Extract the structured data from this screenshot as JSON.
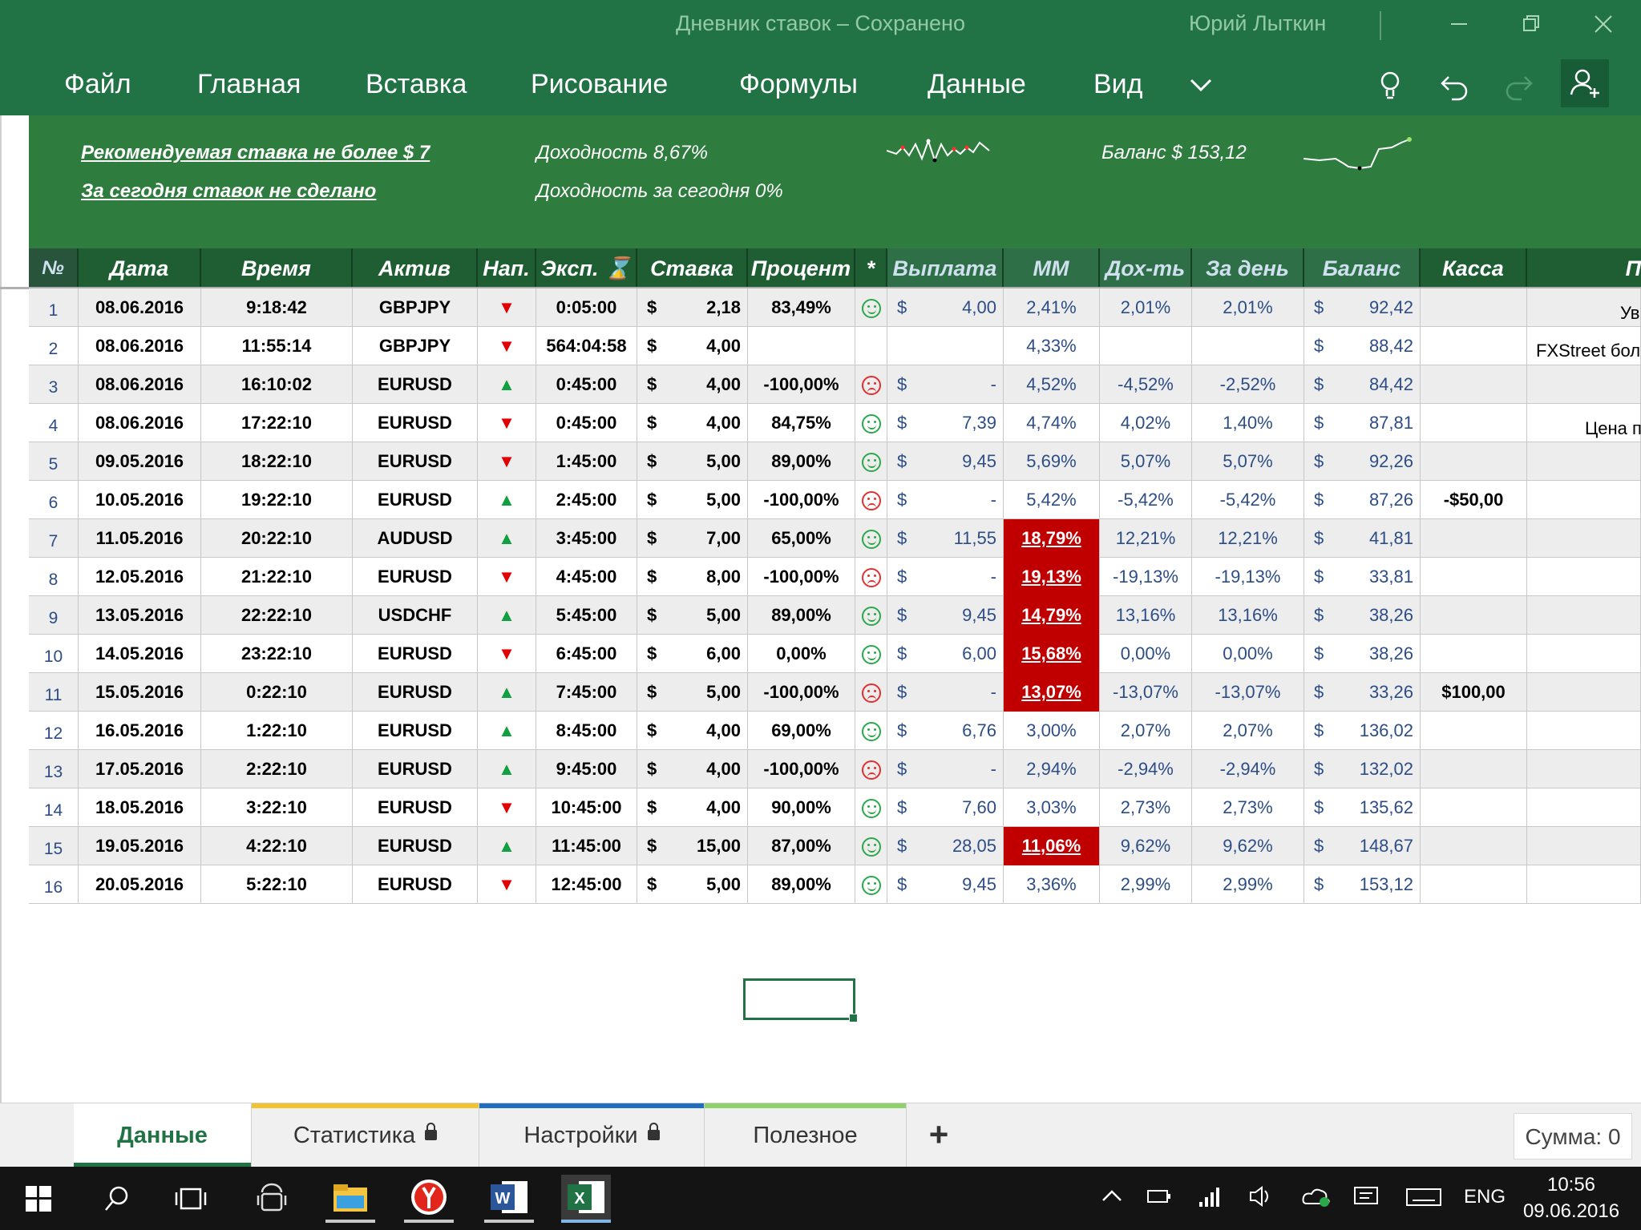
{
  "titlebar": {
    "title": "Дневник ставок – Сохранено",
    "user": "Юрий Лыткин"
  },
  "menu": [
    "Файл",
    "Главная",
    "Вставка",
    "Рисование",
    "Формулы",
    "Данные",
    "Вид"
  ],
  "banner": {
    "recommend": "Рекомендуемая ставка не более $ 7",
    "no_bets_today": "За сегодня ставок не сделано",
    "yield": "Доходность  8,67%",
    "yield_today": "Доходность за сегодня  0%",
    "balance": "Баланс  $ 153,12"
  },
  "headers": {
    "num": "№",
    "date": "Дата",
    "time": "Время",
    "asset": "Актив",
    "dir": "Нап.",
    "exp": "Эксп.",
    "stake": "Ставка",
    "pct": "Процент",
    "star": "*",
    "payout": "Выплата",
    "mm": "ММ",
    "yield": "Дох-ть",
    "day": "За день",
    "balance": "Баланс",
    "cash": "Касса",
    "extra": "П"
  },
  "rows": [
    {
      "n": "1",
      "date": "08.06.2016",
      "time": "9:18:42",
      "asset": "GBPJPY",
      "dir": "down",
      "exp": "0:05:00",
      "stake": "2,18",
      "pct": "83,49%",
      "res": "win",
      "pay": "4,00",
      "mm": "2,41%",
      "mmred": false,
      "yld": "2,01%",
      "day": "2,01%",
      "bal": "92,42",
      "cash": ""
    },
    {
      "n": "2",
      "date": "08.06.2016",
      "time": "11:55:14",
      "asset": "GBPJPY",
      "dir": "down",
      "exp": "564:04:58",
      "stake": "4,00",
      "pct": "",
      "res": "",
      "pay": "",
      "mm": "4,33%",
      "mmred": false,
      "yld": "",
      "day": "",
      "bal": "88,42",
      "cash": ""
    },
    {
      "n": "3",
      "date": "08.06.2016",
      "time": "16:10:02",
      "asset": "EURUSD",
      "dir": "up",
      "exp": "0:45:00",
      "stake": "4,00",
      "pct": "-100,00%",
      "res": "loss",
      "pay": "-",
      "mm": "4,52%",
      "mmred": false,
      "yld": "-4,52%",
      "day": "-2,52%",
      "bal": "84,42",
      "cash": ""
    },
    {
      "n": "4",
      "date": "08.06.2016",
      "time": "17:22:10",
      "asset": "EURUSD",
      "dir": "down",
      "exp": "0:45:00",
      "stake": "4,00",
      "pct": "84,75%",
      "res": "win",
      "pay": "7,39",
      "mm": "4,74%",
      "mmred": false,
      "yld": "4,02%",
      "day": "1,40%",
      "bal": "87,81",
      "cash": ""
    },
    {
      "n": "5",
      "date": "09.05.2016",
      "time": "18:22:10",
      "asset": "EURUSD",
      "dir": "down",
      "exp": "1:45:00",
      "stake": "5,00",
      "pct": "89,00%",
      "res": "win",
      "pay": "9,45",
      "mm": "5,69%",
      "mmred": false,
      "yld": "5,07%",
      "day": "5,07%",
      "bal": "92,26",
      "cash": ""
    },
    {
      "n": "6",
      "date": "10.05.2016",
      "time": "19:22:10",
      "asset": "EURUSD",
      "dir": "up",
      "exp": "2:45:00",
      "stake": "5,00",
      "pct": "-100,00%",
      "res": "loss",
      "pay": "-",
      "mm": "5,42%",
      "mmred": false,
      "yld": "-5,42%",
      "day": "-5,42%",
      "bal": "87,26",
      "cash": "-$50,00"
    },
    {
      "n": "7",
      "date": "11.05.2016",
      "time": "20:22:10",
      "asset": "AUDUSD",
      "dir": "up",
      "exp": "3:45:00",
      "stake": "7,00",
      "pct": "65,00%",
      "res": "win",
      "pay": "11,55",
      "mm": "18,79%",
      "mmred": true,
      "yld": "12,21%",
      "day": "12,21%",
      "bal": "41,81",
      "cash": ""
    },
    {
      "n": "8",
      "date": "12.05.2016",
      "time": "21:22:10",
      "asset": "EURUSD",
      "dir": "down",
      "exp": "4:45:00",
      "stake": "8,00",
      "pct": "-100,00%",
      "res": "loss",
      "pay": "-",
      "mm": "19,13%",
      "mmred": true,
      "yld": "-19,13%",
      "day": "-19,13%",
      "bal": "33,81",
      "cash": ""
    },
    {
      "n": "9",
      "date": "13.05.2016",
      "time": "22:22:10",
      "asset": "USDCHF",
      "dir": "up",
      "exp": "5:45:00",
      "stake": "5,00",
      "pct": "89,00%",
      "res": "win",
      "pay": "9,45",
      "mm": "14,79%",
      "mmred": true,
      "yld": "13,16%",
      "day": "13,16%",
      "bal": "38,26",
      "cash": ""
    },
    {
      "n": "10",
      "date": "14.05.2016",
      "time": "23:22:10",
      "asset": "EURUSD",
      "dir": "down",
      "exp": "6:45:00",
      "stake": "6,00",
      "pct": "0,00%",
      "res": "win",
      "pay": "6,00",
      "mm": "15,68%",
      "mmred": true,
      "yld": "0,00%",
      "day": "0,00%",
      "bal": "38,26",
      "cash": ""
    },
    {
      "n": "11",
      "date": "15.05.2016",
      "time": "0:22:10",
      "asset": "EURUSD",
      "dir": "up",
      "exp": "7:45:00",
      "stake": "5,00",
      "pct": "-100,00%",
      "res": "loss",
      "pay": "-",
      "mm": "13,07%",
      "mmred": true,
      "yld": "-13,07%",
      "day": "-13,07%",
      "bal": "33,26",
      "cash": "$100,00"
    },
    {
      "n": "12",
      "date": "16.05.2016",
      "time": "1:22:10",
      "asset": "EURUSD",
      "dir": "up",
      "exp": "8:45:00",
      "stake": "4,00",
      "pct": "69,00%",
      "res": "win",
      "pay": "6,76",
      "mm": "3,00%",
      "mmred": false,
      "yld": "2,07%",
      "day": "2,07%",
      "bal": "136,02",
      "cash": ""
    },
    {
      "n": "13",
      "date": "17.05.2016",
      "time": "2:22:10",
      "asset": "EURUSD",
      "dir": "up",
      "exp": "9:45:00",
      "stake": "4,00",
      "pct": "-100,00%",
      "res": "loss",
      "pay": "-",
      "mm": "2,94%",
      "mmred": false,
      "yld": "-2,94%",
      "day": "-2,94%",
      "bal": "132,02",
      "cash": ""
    },
    {
      "n": "14",
      "date": "18.05.2016",
      "time": "3:22:10",
      "asset": "EURUSD",
      "dir": "down",
      "exp": "10:45:00",
      "stake": "4,00",
      "pct": "90,00%",
      "res": "win",
      "pay": "7,60",
      "mm": "3,03%",
      "mmred": false,
      "yld": "2,73%",
      "day": "2,73%",
      "bal": "135,62",
      "cash": ""
    },
    {
      "n": "15",
      "date": "19.05.2016",
      "time": "4:22:10",
      "asset": "EURUSD",
      "dir": "up",
      "exp": "11:45:00",
      "stake": "15,00",
      "pct": "87,00%",
      "res": "win",
      "pay": "28,05",
      "mm": "11,06%",
      "mmred": true,
      "yld": "9,62%",
      "day": "9,62%",
      "bal": "148,67",
      "cash": ""
    },
    {
      "n": "16",
      "date": "20.05.2016",
      "time": "5:22:10",
      "asset": "EURUSD",
      "dir": "down",
      "exp": "12:45:00",
      "stake": "5,00",
      "pct": "89,00%",
      "res": "win",
      "pay": "9,45",
      "mm": "3,36%",
      "mmred": false,
      "yld": "2,99%",
      "day": "2,99%",
      "bal": "153,12",
      "cash": ""
    }
  ],
  "side_notes": [
    "Ув",
    "FXStreet бол",
    "Цена п"
  ],
  "currency_symbol": "$",
  "sheet_tabs": [
    {
      "label": "Данные",
      "active": true,
      "color": "#217346"
    },
    {
      "label": "Статистика",
      "locked": true,
      "color": "#f2c230"
    },
    {
      "label": "Настройки",
      "locked": true,
      "color": "#1f6fc0"
    },
    {
      "label": "Полезное",
      "color": "#8fd16a"
    }
  ],
  "sum": "Сумма: 0",
  "taskbar": {
    "lang": "ENG",
    "time": "10:56",
    "date": "09.06.2016"
  },
  "icons": {
    "win_minimize": "minimize-icon",
    "win_restore": "restore-icon",
    "win_close": "close-icon",
    "ribbon_more": "chevron-down-icon",
    "tell_me": "lightbulb-icon",
    "undo": "undo-icon",
    "redo": "redo-icon",
    "share": "share-user-icon"
  }
}
